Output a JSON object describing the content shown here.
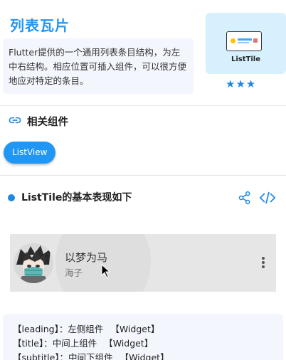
{
  "header": {
    "title": "列表瓦片",
    "description": "Flutter提供的一个通用列表条目结构，为左中右结构。相应位置可插入组件，可以很方便地应对特定的条目。",
    "thumbnail_label": "ListTile",
    "stars": "★★★",
    "rating": 3
  },
  "related": {
    "title": "相关组件",
    "chips": [
      "ListView"
    ]
  },
  "section": {
    "title": "ListTile的基本表现如下"
  },
  "demo": {
    "title": "以梦为马",
    "subtitle": "海子"
  },
  "properties": [
    {
      "text": "【leading】：左侧组件",
      "type": "【Widget】"
    },
    {
      "text": "【title】：中间上组件",
      "type": "【Widget】"
    },
    {
      "text": "【subtitle】：中间下组件",
      "type": "【Widget】"
    }
  ],
  "colors": {
    "accent": "#2196f3",
    "card_bg": "#f3f6fc",
    "thumb_bg": "#d6f1fd",
    "demo_bg": "#e6e6e6"
  }
}
